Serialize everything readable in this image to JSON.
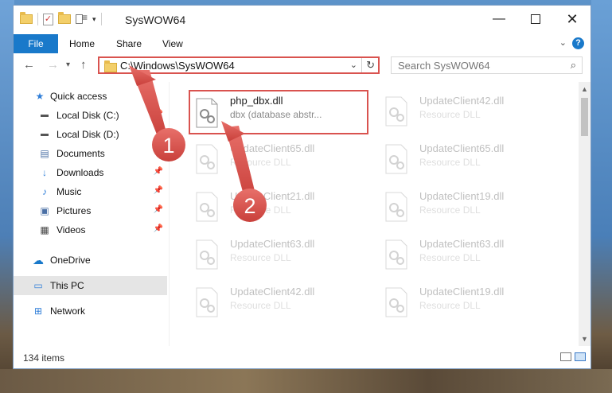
{
  "window": {
    "title": "SysWOW64"
  },
  "ribbon": {
    "tabs": [
      "File",
      "Home",
      "Share",
      "View"
    ],
    "help": "?"
  },
  "address": {
    "path": "C:\\Windows\\SysWOW64"
  },
  "search": {
    "placeholder": "Search SysWOW64"
  },
  "sidebar": {
    "items": [
      {
        "label": "Quick access"
      },
      {
        "label": "Local Disk (C:)"
      },
      {
        "label": "Local Disk (D:)"
      },
      {
        "label": "Documents"
      },
      {
        "label": "Downloads"
      },
      {
        "label": "Music"
      },
      {
        "label": "Pictures"
      },
      {
        "label": "Videos"
      },
      {
        "label": "OneDrive"
      },
      {
        "label": "This PC"
      },
      {
        "label": "Network"
      }
    ]
  },
  "files": {
    "items": [
      {
        "name": "php_dbx.dll",
        "desc": "dbx (database abstr..."
      },
      {
        "name": "UpdateClient42.dll",
        "desc": "Resource DLL"
      },
      {
        "name": "UpdateClient65.dll",
        "desc": "Resource DLL"
      },
      {
        "name": "UpdateClient65.dll",
        "desc": "Resource DLL"
      },
      {
        "name": "UpdateClient21.dll",
        "desc": "Resource DLL"
      },
      {
        "name": "UpdateClient19.dll",
        "desc": "Resource DLL"
      },
      {
        "name": "UpdateClient63.dll",
        "desc": "Resource DLL"
      },
      {
        "name": "UpdateClient63.dll",
        "desc": "Resource DLL"
      },
      {
        "name": "UpdateClient42.dll",
        "desc": "Resource DLL"
      },
      {
        "name": "UpdateClient19.dll",
        "desc": "Resource DLL"
      }
    ]
  },
  "status": {
    "count": "134 items"
  },
  "callouts": {
    "one": "1",
    "two": "2"
  },
  "colors": {
    "accent": "#1979ca",
    "callout": "#d9534f",
    "selected": "#e5e5e5"
  }
}
